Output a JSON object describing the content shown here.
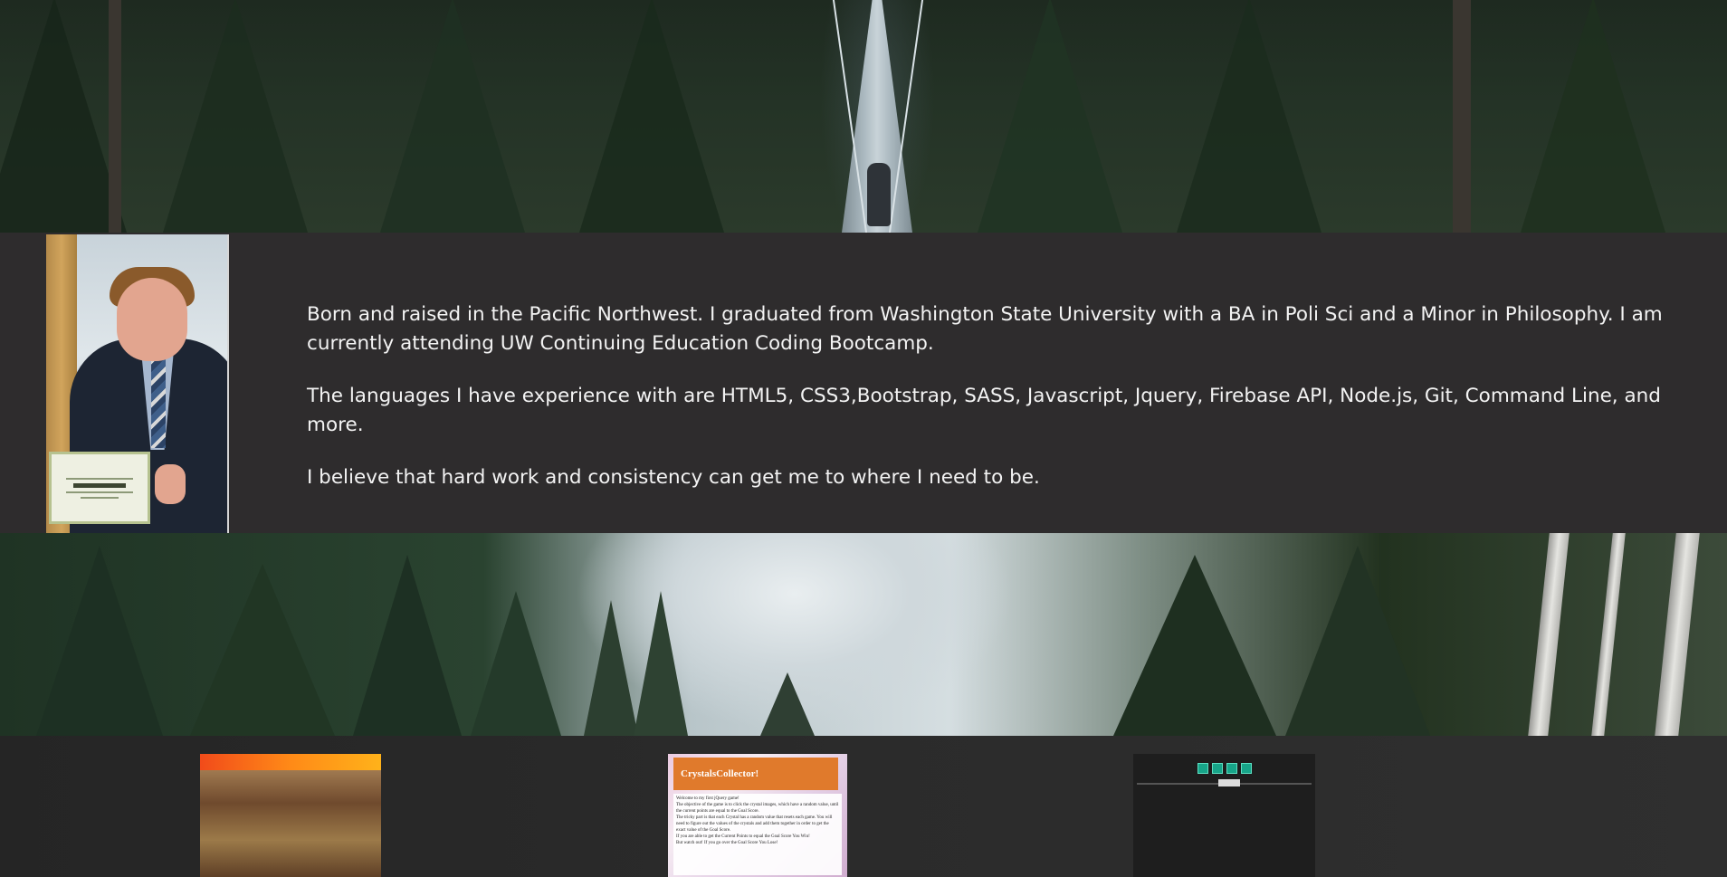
{
  "about": {
    "paragraphs": [
      "Born and raised in the Pacific Northwest. I graduated from Washington State University with a BA in Poli Sci and a Minor in Philosophy. I am currently attending UW Continuing Education Coding Bootcamp.",
      "The languages I have experience with are HTML5, CSS3,Bootstrap, SASS, Javascript, Jquery, Firebase API, Node.js, Git, Command Line, and more.",
      "I believe that hard work and consistency can get me to where I need to be."
    ]
  },
  "portfolio": {
    "items": [
      {
        "title": ""
      },
      {
        "title": "CrystalsCollector!",
        "body_lines": [
          "Welcome to my first jQuery game!",
          "The objective of the game is to click the crystal images, which have a random value, until the current points are equal to the Goal Score.",
          "The tricky part is that each Crystal has a random value that resets each game. You will need to figure out the values of the crystals and add them together in order to get the exact value of the Goal Score.",
          "If you are able to get the Current Points to equal the Goal Score You Win!",
          "But watch out! If you go over the Goal Score You Lose!"
        ]
      },
      {
        "title": ""
      }
    ]
  }
}
